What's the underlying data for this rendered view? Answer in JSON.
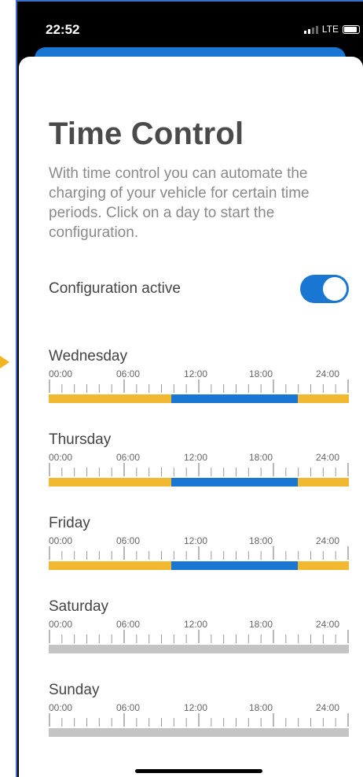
{
  "status_bar": {
    "time": "22:52",
    "network": "LTE"
  },
  "page": {
    "title": "Time Control",
    "description": "With time control you can automate the charging of your vehicle for certain time periods. Click on a day to start the configuration.",
    "config_label": "Configuration active",
    "config_active": true
  },
  "timeline_labels": [
    "00:00",
    "06:00",
    "12:00",
    "18:00",
    "24:00"
  ],
  "colors": {
    "accent": "#1976d2",
    "yellow": "#f0b931",
    "inactive": "#c4c4c4"
  },
  "days": [
    {
      "name": "Wednesday",
      "segments": [
        {
          "color": "yellow",
          "from": 0,
          "to": 9.8
        },
        {
          "color": "blue",
          "from": 9.8,
          "to": 19.9
        },
        {
          "color": "yellow",
          "from": 19.9,
          "to": 24
        }
      ]
    },
    {
      "name": "Thursday",
      "segments": [
        {
          "color": "yellow",
          "from": 0,
          "to": 9.8
        },
        {
          "color": "blue",
          "from": 9.8,
          "to": 19.9
        },
        {
          "color": "yellow",
          "from": 19.9,
          "to": 24
        }
      ]
    },
    {
      "name": "Friday",
      "segments": [
        {
          "color": "yellow",
          "from": 0,
          "to": 9.8
        },
        {
          "color": "blue",
          "from": 9.8,
          "to": 19.9
        },
        {
          "color": "yellow",
          "from": 19.9,
          "to": 24
        }
      ]
    },
    {
      "name": "Saturday",
      "segments": [
        {
          "color": "gray",
          "from": 0,
          "to": 24
        }
      ]
    },
    {
      "name": "Sunday",
      "segments": [
        {
          "color": "gray",
          "from": 0,
          "to": 24
        }
      ]
    }
  ]
}
